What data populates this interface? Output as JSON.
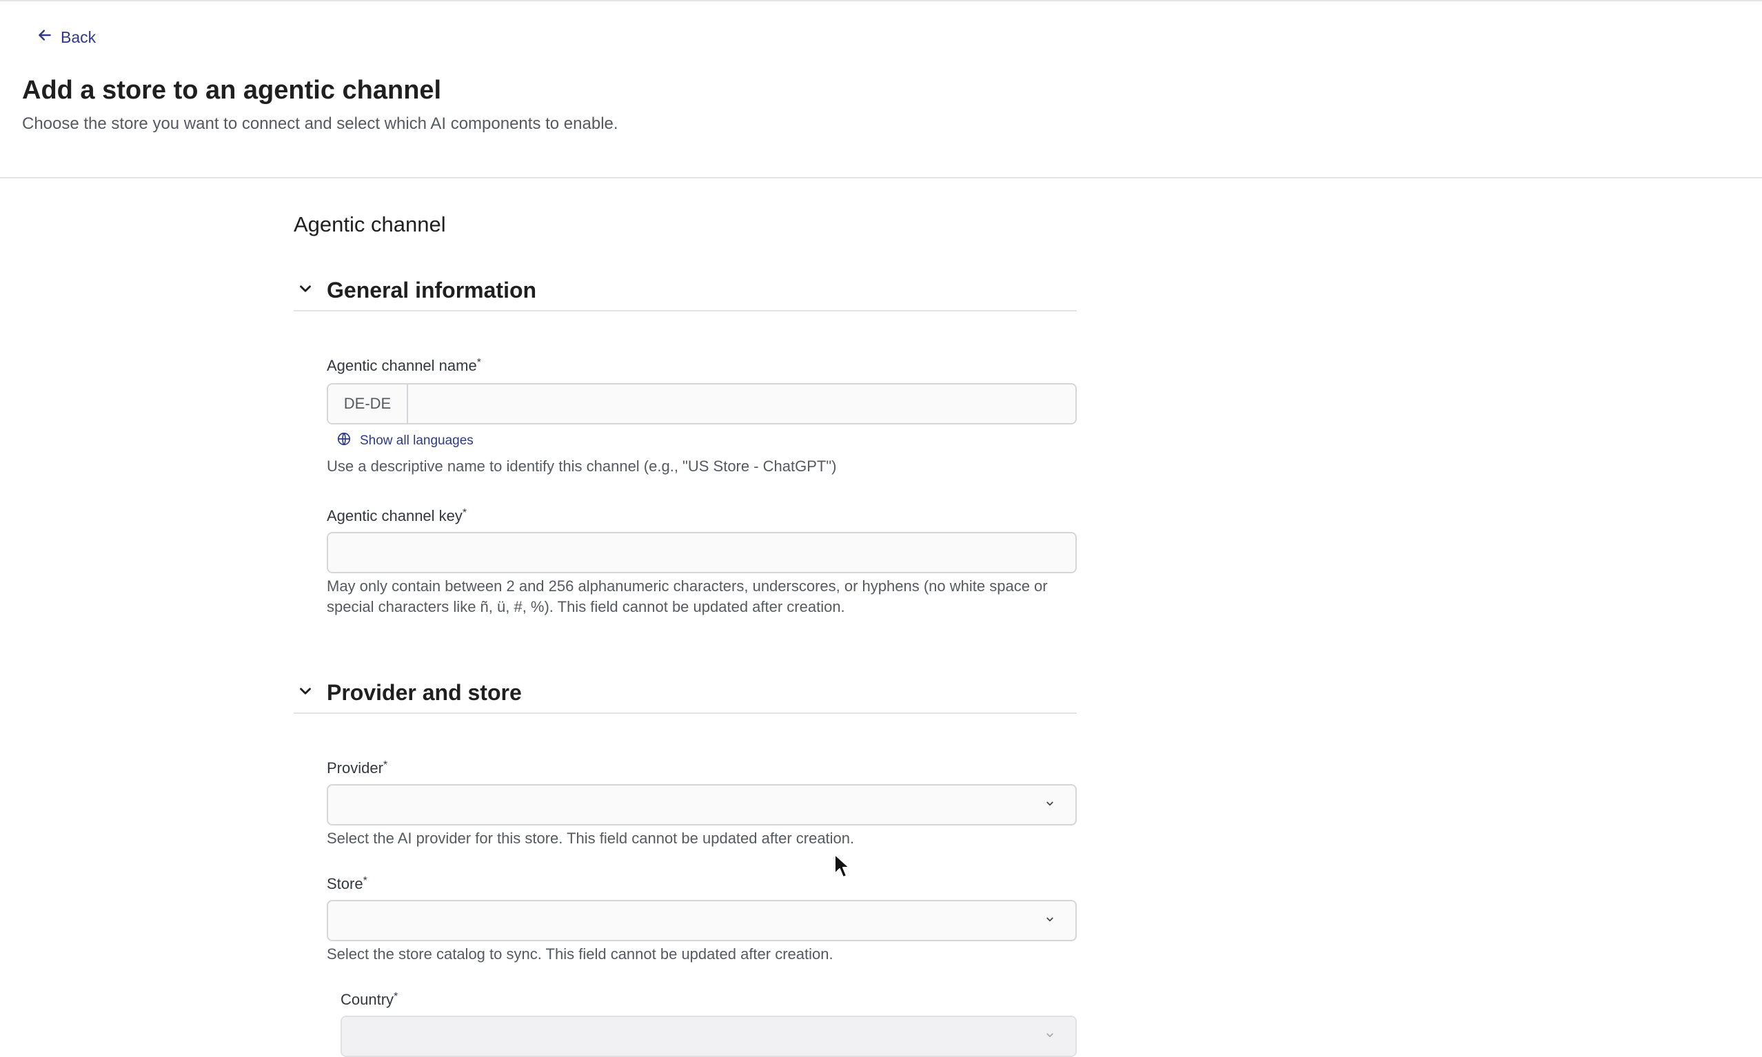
{
  "header": {
    "back_label": "Back",
    "title": "Add a store to an agentic channel",
    "subtitle": "Choose the store you want to connect and select which AI components to enable."
  },
  "form": {
    "title": "Agentic channel",
    "sections": [
      {
        "title": "General information",
        "fields": {
          "channel_name": {
            "label": "Agentic channel name",
            "required_mark": "*",
            "lang_prefix": "DE-DE",
            "value": "",
            "show_languages": "Show all languages",
            "help": "Use a descriptive name to identify this channel (e.g., \"US Store - ChatGPT\")"
          },
          "channel_key": {
            "label": "Agentic channel key",
            "required_mark": "*",
            "value": "",
            "help": "May only contain between 2 and 256 alphanumeric characters, underscores, or hyphens (no white space or special characters like ñ, ü, #, %). This field cannot be updated after creation."
          }
        }
      },
      {
        "title": "Provider and store",
        "fields": {
          "provider": {
            "label": "Provider",
            "required_mark": "*",
            "value": "",
            "help": "Select the AI provider for this store. This field cannot be updated after creation."
          },
          "store": {
            "label": "Store",
            "required_mark": "*",
            "value": "",
            "help": "Select the store catalog to sync. This field cannot be updated after creation."
          },
          "country": {
            "label": "Country",
            "required_mark": "*",
            "value": ""
          }
        }
      }
    ]
  },
  "icons": {
    "back": "arrow-left-icon",
    "collapse": "chevron-down-icon",
    "globe": "globe-icon",
    "select": "chevron-down-icon",
    "cursor": "mouse-pointer-icon"
  },
  "colors": {
    "link": "#2d3a8c",
    "border": "#d6d6da",
    "text": "#1f1f1f",
    "muted": "#555a60"
  }
}
